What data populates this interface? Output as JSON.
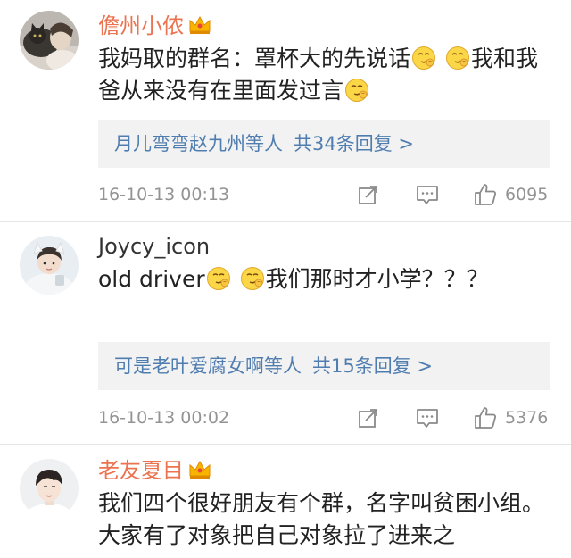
{
  "comments": [
    {
      "username": "儋州小侬",
      "body_parts": [
        "我妈取的群名：罩杯大的先说话",
        "我和我爸从来没有在里面发过言"
      ],
      "reply_names": "月儿弯弯赵九州等人",
      "reply_count": "共34条回复 >",
      "time": "16-10-13 00:13",
      "likes": "6095"
    },
    {
      "username": "Joycy_icon",
      "body_parts": [
        "old driver",
        "我们那时才小学？？？"
      ],
      "reply_names": "可是老叶爱腐女啊等人",
      "reply_count": "共15条回复 >",
      "time": "16-10-13 00:02",
      "likes": "5376"
    },
    {
      "username": "老友夏目",
      "body_parts": [
        "我们四个很好朋友有个群，名字叫贫困小组。大家有了对象把自己对象拉了进来之"
      ]
    }
  ],
  "icons": {
    "repost": "repost-icon",
    "comment": "comment-icon",
    "like": "thumbs-up-icon",
    "vip": "crown-icon",
    "emoji": "smirk-emoji-icon"
  },
  "colors": {
    "vip_name": "#eb7350",
    "link": "#507daf",
    "meta": "#939393",
    "reply_bg": "#f2f2f2"
  }
}
